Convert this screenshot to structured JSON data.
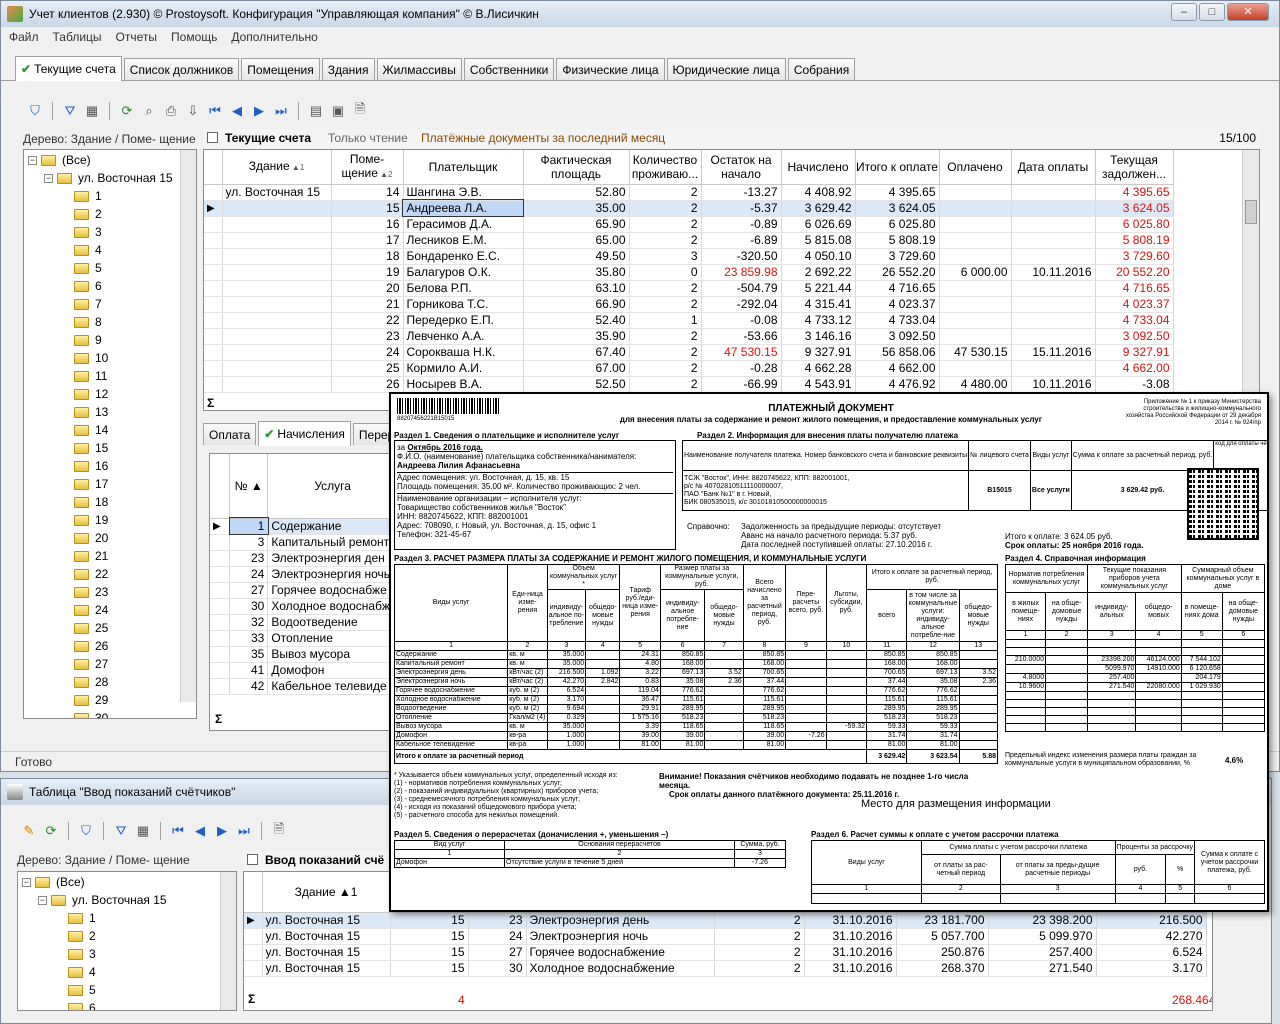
{
  "main_window": {
    "title": "Учет клиентов (2.930) © Prostoysoft. Конфигурация \"Управляющая компания\" © В.Лисичкин",
    "menu": [
      "Файл",
      "Таблицы",
      "Отчеты",
      "Помощь",
      "Дополнительно"
    ],
    "tabs": [
      "Текущие счета",
      "Список должников",
      "Помещения",
      "Здания",
      "Жилмассивы",
      "Собственники",
      "Физические лица",
      "Юридические лица",
      "Собрания"
    ],
    "tree_header": "Дерево: Здание / Поме- щение",
    "tree_root": "(Все)",
    "tree_building": "ул. Восточная 15",
    "tree_items": [
      "1",
      "2",
      "3",
      "4",
      "5",
      "6",
      "7",
      "8",
      "9",
      "10",
      "11",
      "12",
      "13",
      "14",
      "15",
      "16",
      "17",
      "18",
      "19",
      "20",
      "21",
      "22",
      "23",
      "24",
      "25",
      "26",
      "27",
      "28",
      "29",
      "30"
    ],
    "panel_title": "Текущие счета",
    "readonly": "Только чтение",
    "panel_desc": "Платёжные документы за последний месяц",
    "counter": "15/100",
    "status": "Готово",
    "sigma": "Σ"
  },
  "accounts": {
    "columns": [
      "Здание",
      "Поме- щение",
      "Плательщик",
      "Фактическая площадь",
      "Количество проживаю...",
      "Остаток на начало",
      "Начислено",
      "Итого к оплате",
      "Оплачено",
      "Дата оплаты",
      "Текущая задолжен..."
    ],
    "building": "ул. Восточная 15",
    "rows": [
      {
        "room": "14",
        "payer": "Шангина Э.В.",
        "area": "52.80",
        "people": "2",
        "start": "-13.27",
        "start_red": false,
        "charged": "4 408.92",
        "total": "4 395.65",
        "paid": "",
        "date": "",
        "debt": "4 395.65",
        "debt_red": true
      },
      {
        "room": "15",
        "payer": "Андреева Л.А.",
        "area": "35.00",
        "people": "2",
        "start": "-5.37",
        "start_red": false,
        "charged": "3 629.42",
        "total": "3 624.05",
        "paid": "",
        "date": "",
        "debt": "3 624.05",
        "debt_red": true
      },
      {
        "room": "16",
        "payer": "Герасимов Д.А.",
        "area": "65.90",
        "people": "2",
        "start": "-0.89",
        "start_red": false,
        "charged": "6 026.69",
        "total": "6 025.80",
        "paid": "",
        "date": "",
        "debt": "6 025.80",
        "debt_red": true
      },
      {
        "room": "17",
        "payer": "Лесников Е.М.",
        "area": "65.00",
        "people": "2",
        "start": "-6.89",
        "start_red": false,
        "charged": "5 815.08",
        "total": "5 808.19",
        "paid": "",
        "date": "",
        "debt": "5 808.19",
        "debt_red": true
      },
      {
        "room": "18",
        "payer": "Бондаренко Е.С.",
        "area": "49.50",
        "people": "3",
        "start": "-320.50",
        "start_red": false,
        "charged": "4 050.10",
        "total": "3 729.60",
        "paid": "",
        "date": "",
        "debt": "3 729.60",
        "debt_red": true
      },
      {
        "room": "19",
        "payer": "Балагуров О.К.",
        "area": "35.80",
        "people": "0",
        "start": "23 859.98",
        "start_red": true,
        "charged": "2 692.22",
        "total": "26 552.20",
        "paid": "6 000.00",
        "date": "10.11.2016",
        "debt": "20 552.20",
        "debt_red": true
      },
      {
        "room": "20",
        "payer": "Белова Р.П.",
        "area": "63.10",
        "people": "2",
        "start": "-504.79",
        "start_red": false,
        "charged": "5 221.44",
        "total": "4 716.65",
        "paid": "",
        "date": "",
        "debt": "4 716.65",
        "debt_red": true
      },
      {
        "room": "21",
        "payer": "Горникова Т.С.",
        "area": "66.90",
        "people": "2",
        "start": "-292.04",
        "start_red": false,
        "charged": "4 315.41",
        "total": "4 023.37",
        "paid": "",
        "date": "",
        "debt": "4 023.37",
        "debt_red": true
      },
      {
        "room": "22",
        "payer": "Передерко Е.П.",
        "area": "52.40",
        "people": "1",
        "start": "-0.08",
        "start_red": false,
        "charged": "4 733.12",
        "total": "4 733.04",
        "paid": "",
        "date": "",
        "debt": "4 733.04",
        "debt_red": true
      },
      {
        "room": "23",
        "payer": "Левченко А.А.",
        "area": "35.90",
        "people": "2",
        "start": "-53.66",
        "start_red": false,
        "charged": "3 146.16",
        "total": "3 092.50",
        "paid": "",
        "date": "",
        "debt": "3 092.50",
        "debt_red": true
      },
      {
        "room": "24",
        "payer": "Сорокваша Н.К.",
        "area": "67.40",
        "people": "2",
        "start": "47 530.15",
        "start_red": true,
        "charged": "9 327.91",
        "total": "56 858.06",
        "paid": "47 530.15",
        "date": "15.11.2016",
        "debt": "9 327.91",
        "debt_red": true
      },
      {
        "room": "25",
        "payer": "Кормило А.И.",
        "area": "67.00",
        "people": "2",
        "start": "-0.28",
        "start_red": false,
        "charged": "4 662.28",
        "total": "4 662.00",
        "paid": "",
        "date": "",
        "debt": "4 662.00",
        "debt_red": true
      },
      {
        "room": "26",
        "payer": "Носырев В.А.",
        "area": "52.50",
        "people": "2",
        "start": "-66.99",
        "start_red": false,
        "charged": "4 543.91",
        "total": "4 476.92",
        "paid": "4 480.00",
        "date": "10.11.2016",
        "debt": "-3.08",
        "debt_red": false
      }
    ]
  },
  "subtabs": [
    "Оплата",
    "Начисления",
    "Перера"
  ],
  "services": {
    "columns": [
      "№",
      "Услуга"
    ],
    "rows": [
      {
        "n": "1",
        "name": "Содержание"
      },
      {
        "n": "3",
        "name": "Капитальный ремонт"
      },
      {
        "n": "23",
        "name": "Электроэнергия ден"
      },
      {
        "n": "24",
        "name": "Электроэнергия ночь"
      },
      {
        "n": "27",
        "name": "Горячее водоснабже"
      },
      {
        "n": "30",
        "name": "Холодное водоснабж"
      },
      {
        "n": "32",
        "name": "Водоотведение"
      },
      {
        "n": "33",
        "name": "Отопление"
      },
      {
        "n": "35",
        "name": "Вывоз мусора"
      },
      {
        "n": "41",
        "name": "Домофон"
      },
      {
        "n": "42",
        "name": "Кабельное телевиде"
      }
    ]
  },
  "second_window": {
    "title": "Таблица \"Ввод показаний счётчиков\"",
    "tree_header": "Дерево: Здание / Поме- щение",
    "tree_root": "(Все)",
    "tree_building": "ул. Восточная 15",
    "tree_items": [
      "1",
      "2",
      "3",
      "4",
      "5",
      "6"
    ],
    "panel_title": "Ввод показаний счё",
    "col_building": "Здание",
    "rows": [
      {
        "building": "ул. Восточная 15",
        "room": "15",
        "code": "23",
        "service": "Электроэнергия день",
        "n": "2",
        "date": "31.10.2016",
        "prev": "23 181.700",
        "cur": "23 398.200",
        "diff": "216.500"
      },
      {
        "building": "ул. Восточная 15",
        "room": "15",
        "code": "24",
        "service": "Электроэнергия ночь",
        "n": "2",
        "date": "31.10.2016",
        "prev": "5 057.700",
        "cur": "5 099.970",
        "diff": "42.270"
      },
      {
        "building": "ул. Восточная 15",
        "room": "15",
        "code": "27",
        "service": "Горячее водоснабжение",
        "n": "2",
        "date": "31.10.2016",
        "prev": "250.876",
        "cur": "257.400",
        "diff": "6.524"
      },
      {
        "building": "ул. Восточная 15",
        "room": "15",
        "code": "30",
        "service": "Холодное водоснабжение",
        "n": "2",
        "date": "31.10.2016",
        "prev": "268.370",
        "cur": "271.540",
        "diff": "3.170"
      }
    ],
    "footer_count": "4",
    "footer_sum": "268.464"
  },
  "document": {
    "barcode_text": "88207456221B15015",
    "title": "ПЛАТЕЖНЫЙ ДОКУМЕНТ",
    "subtitle": "для внесения платы за содержание и ремонт жилого помещения, и предоставление коммунальных услуг",
    "appendix": "Приложение № 1 к приказу Министерства строительства и жилищно-коммунального хозяйства Российской Федерации от 29 декабря 2014 г. № 924/пр",
    "sec1": "Раздел 1. Сведения о плательщике и исполнителе услуг",
    "period_label": "за",
    "period": "Октябрь 2016 года.",
    "fio_label": "Ф.И.О. (наименование) плательщика собственника/нанимателя:",
    "fio": "Андреева Лилия Афанасьевна",
    "address": "Адрес помещения: ул. Восточная, д. 15, кв. 15",
    "area_line": "Площадь помещения: 35.00 м². Количество проживающих: 2 чел.",
    "org_label": "Наименование организации – исполнителя услуг:",
    "org": "Товарищество собственников жилья \"Восток\"",
    "inn": "ИНН: 8820745622, КПП: 882001001",
    "org_address": "Адрес: 708090, г. Новый, ул. Восточная, д. 15, офис 1",
    "phone": "Телефон: 321-45-67",
    "sec2": "Раздел 2. Информация для внесения платы получателю платежа",
    "recv_head": "Наименование получателя платежа. Номер банковского счета и банковские реквизиты",
    "acc_head": "№ лицевого счета",
    "svc_head": "Виды услуг",
    "sum_head": "Сумма к оплате за расчетный период, руб.",
    "qr_head": "код для оплаты через устройство самообслуживания",
    "recv1": "ТСЖ \"Восток\", ИНН: 8820745622, КПП: 882001001,",
    "recv2": "р/с № 40702810511110000007,",
    "recv3": "ПАО \"Банк №1\" в г. Новый,",
    "recv4": "БИК 080535015, к/с 30101810500000000015",
    "acc": "B15015",
    "svc": "Все услуги",
    "sum": "3 629.42 руб.",
    "ref_label": "Справочно:",
    "ref1": "Задолженность за предыдущие периоды: отсутствует",
    "ref2": "Аванс на начало расчетного периода: 5.37 руб.",
    "ref3": "Дата последней поступившей оплаты: 27.10.2016 г.",
    "total_line": "Итого к оплате: 3 624.05 руб.",
    "due_line": "Срок оплаты: 25 ноября 2016 года.",
    "sec3": "Раздел 3. РАСЧЕТ РАЗМЕРА ПЛАТЫ ЗА СОДЕРЖАНИЕ И РЕМОНТ ЖИЛОГО ПОМЕЩЕНИЯ, И КОММУНАЛЬНЫЕ УСЛУГИ",
    "sec4": "Раздел 4. Справочная информация",
    "calc_head": [
      "Виды услуг",
      "Еди-ница изме-рения",
      "Объем коммунальных услуг *",
      "Тариф руб./еди-ница изме-рения",
      "Размер платы за коммунальные услуги, руб.",
      "Всего начислено за расчетный период, руб.",
      "Пере-расчеты всего, руб.",
      "Льготы, субсидии, руб.",
      "Итого к оплате за расчетный период, руб."
    ],
    "calc_sub": [
      "индивиду-альное по-требление",
      "общедо-мовые нужды",
      "индивиду-альное потребле-ние",
      "общедо-мовые нужды",
      "всего",
      "в том числе за коммунальные услуги: индивиду-альное потребле-ние",
      "общедо-мовые нужды"
    ],
    "calc_nums": [
      "1",
      "2",
      "3",
      "4",
      "5",
      "6",
      "7",
      "8",
      "9",
      "10",
      "11",
      "12",
      "13"
    ],
    "calc_rows": [
      [
        "Содержание",
        "кв. м",
        "35.000",
        "",
        "24.31",
        "850.85",
        "",
        "850.85",
        "",
        "",
        "850.85",
        "850.85",
        ""
      ],
      [
        "Капитальный ремонт",
        "кв. м",
        "35.000",
        "",
        "4.80",
        "168.00",
        "",
        "168.00",
        "",
        "",
        "168.00",
        "168.00",
        ""
      ],
      [
        "Электроэнергия день",
        "кВт/час (2)",
        "216.500",
        "1.092",
        "3.22",
        "697.13",
        "3.52",
        "700.65",
        "",
        "",
        "700.65",
        "697.13",
        "3.52"
      ],
      [
        "Электроэнергия ночь",
        "кВт/час (2)",
        "42.270",
        "2.842",
        "0.83",
        "35.08",
        "2.36",
        "37.44",
        "",
        "",
        "37.44",
        "35.08",
        "2.36"
      ],
      [
        "Горячее водоснабжение",
        "куб. м (2)",
        "6.524",
        "",
        "119.04",
        "776.62",
        "",
        "776.62",
        "",
        "",
        "776.62",
        "776.62",
        ""
      ],
      [
        "Холодное водоснабжение",
        "куб. м (2)",
        "3.170",
        "",
        "36.47",
        "115.61",
        "",
        "115.61",
        "",
        "",
        "115.61",
        "115.61",
        ""
      ],
      [
        "Водоотведение",
        "куб. м (2)",
        "9.694",
        "",
        "29.91",
        "289.95",
        "",
        "289.95",
        "",
        "",
        "289.95",
        "289.95",
        ""
      ],
      [
        "Отопление",
        "Гкал/м2 (4)",
        "0.329",
        "",
        "1 575.16",
        "518.23",
        "",
        "518.23",
        "",
        "",
        "518.23",
        "518.23",
        ""
      ],
      [
        "Вывоз мусора",
        "кв. м",
        "35.000",
        "",
        "3.39",
        "118.65",
        "",
        "118.65",
        "",
        "-59.32",
        "59.33",
        "59.33",
        ""
      ],
      [
        "Домофон",
        "кв-ра",
        "1.000",
        "",
        "39.00",
        "39.00",
        "",
        "39.00",
        "-7.26",
        "",
        "31.74",
        "31.74",
        ""
      ],
      [
        "Кабельное телевидение",
        "кв-ра",
        "1.000",
        "",
        "81.00",
        "81.00",
        "",
        "81.00",
        "",
        "",
        "81.00",
        "81.00",
        ""
      ]
    ],
    "calc_total_label": "Итого к оплате за расчетный период",
    "calc_total": [
      "3 629.42",
      "3 623.54",
      "5.88"
    ],
    "ref_head": [
      "Норматив потребления коммунальных услуг",
      "Текущие показания приборов учета коммунальных услуг",
      "Суммарный объем коммунальных услуг в доме"
    ],
    "ref_sub": [
      "в жилых помеще-ниях",
      "на обще-домовые нужды",
      "индивиду-альных",
      "общедо-мовых",
      "в помеще-ниях дома",
      "на обще-домовые нужды"
    ],
    "ref_nums": [
      "1",
      "2",
      "3",
      "4",
      "5",
      "6"
    ],
    "ref_rows": [
      [
        "",
        "",
        "",
        "",
        "",
        ""
      ],
      [
        "",
        "",
        "",
        "",
        "",
        ""
      ],
      [
        "210.0000",
        "",
        "23398.200",
        "46124.000",
        "7 544.102",
        ""
      ],
      [
        "",
        "",
        "5099.970",
        "14910.000",
        "6 120.658",
        ""
      ],
      [
        "4.8000",
        "",
        "257.400",
        "",
        "204.179",
        ""
      ],
      [
        "10.9600",
        "",
        "271.540",
        "22080.000",
        "1 029.930",
        ""
      ],
      [
        "",
        "",
        "",
        "",
        "",
        ""
      ],
      [
        "",
        "",
        "",
        "",
        "",
        ""
      ],
      [
        "",
        "",
        "",
        "",
        "",
        ""
      ],
      [
        "",
        "",
        "",
        "",
        "",
        ""
      ],
      [
        "",
        "",
        "",
        "",
        "",
        ""
      ]
    ],
    "limit_text": "Предельный индекс изменения размера платы граждан за коммунальные услуги в муниципальном образовании, %",
    "limit_val": "4.6%",
    "notes": [
      "* Указывается объем коммунальных услуг, определенный исходя из:",
      "(1) - нормативов потребления коммунальных услуг;",
      "(2) - показаний индивидуальных (квартирных) приборов учета;",
      "(3) - среднемесячного потребления коммунальных услуг;",
      "(4) - исходя из показаний общедомового прибора учета;",
      "(5) - расчетного способа для нежилых помещений."
    ],
    "attention1": "Внимание! Показания счётчиков необходимо подавать не позднее 1-го числа месяца.",
    "attention2": "Срок оплаты данного платёжного документа: 25.11.2016 г.",
    "info_place": "Место для размещения информации",
    "sec5": "Раздел 5. Сведения о перерасчетах (доначисления +, уменьшения –)",
    "sec5_head": [
      "Вид услуг",
      "Основания перерасчетов",
      "Сумма, руб."
    ],
    "sec5_nums": [
      "1",
      "2",
      "3"
    ],
    "sec5_row": [
      "Домофон",
      "Отсутствие услуги в течение 5 дней",
      "-7.26"
    ],
    "sec6": "Раздел 6. Расчет суммы к оплате с учетом рассрочки платежа",
    "sec6_head": [
      "Виды услуг",
      "Сумма платы с учетом рассрочки платежа",
      "Проценты за рассрочку",
      "Сумма к оплате с учетом рассрочки платежа, руб."
    ],
    "sec6_sub": [
      "от платы за рас-четный период",
      "от платы за преды-дущие расчетные периоды",
      "руб.",
      "%"
    ],
    "sec6_nums": [
      "1",
      "2",
      "3",
      "4",
      "5",
      "6"
    ]
  }
}
